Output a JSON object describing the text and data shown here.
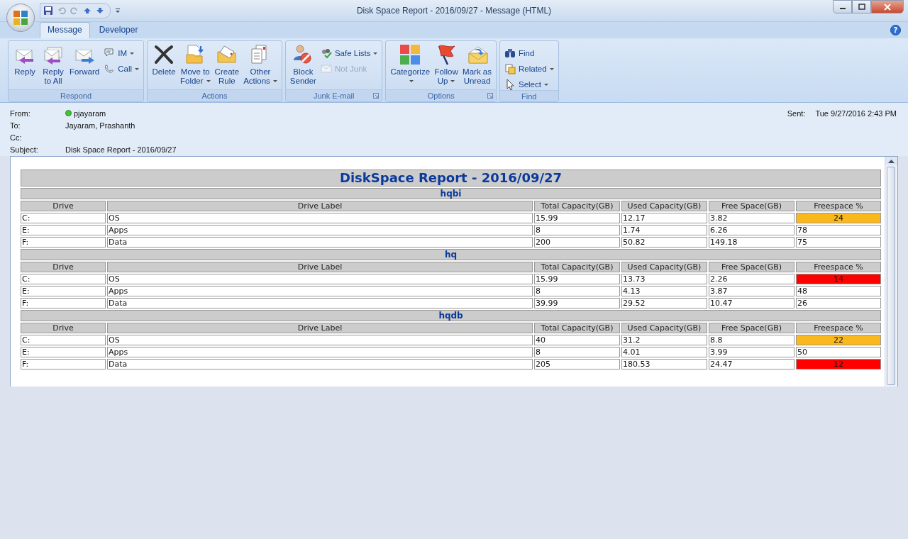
{
  "window": {
    "title": "Disk Space Report - 2016/09/27 - Message (HTML)"
  },
  "help_button": "?",
  "tabs": [
    {
      "label": "Message",
      "selected": true
    },
    {
      "label": "Developer",
      "selected": false
    }
  ],
  "ribbon": {
    "groups": [
      {
        "label": "Respond",
        "launcher": false,
        "items": [
          {
            "kind": "large",
            "lines": [
              "Reply"
            ],
            "dropdown": false,
            "disabled": false
          },
          {
            "kind": "large",
            "lines": [
              "Reply",
              "to All"
            ],
            "dropdown": false,
            "disabled": false
          },
          {
            "kind": "large",
            "lines": [
              "Forward"
            ],
            "dropdown": false,
            "disabled": false
          },
          {
            "kind": "small",
            "lines": [
              "IM"
            ],
            "dropdown": true,
            "disabled": false
          },
          {
            "kind": "small",
            "lines": [
              "Call"
            ],
            "dropdown": true,
            "disabled": false
          }
        ]
      },
      {
        "label": "Actions",
        "launcher": false,
        "items": [
          {
            "kind": "large",
            "lines": [
              "Delete"
            ],
            "dropdown": false,
            "disabled": false
          },
          {
            "kind": "large",
            "lines": [
              "Move to",
              "Folder"
            ],
            "dropdown": true,
            "disabled": false
          },
          {
            "kind": "large",
            "lines": [
              "Create",
              "Rule"
            ],
            "dropdown": false,
            "disabled": false
          },
          {
            "kind": "large",
            "lines": [
              "Other",
              "Actions"
            ],
            "dropdown": true,
            "disabled": false
          }
        ]
      },
      {
        "label": "Junk E-mail",
        "launcher": true,
        "items": [
          {
            "kind": "large",
            "lines": [
              "Block",
              "Sender"
            ],
            "dropdown": false,
            "disabled": false
          },
          {
            "kind": "small",
            "lines": [
              "Safe Lists"
            ],
            "dropdown": true,
            "disabled": false
          },
          {
            "kind": "small",
            "lines": [
              "Not Junk"
            ],
            "dropdown": false,
            "disabled": true
          }
        ]
      },
      {
        "label": "Options",
        "launcher": true,
        "items": [
          {
            "kind": "large",
            "lines": [
              "Categorize"
            ],
            "dropdown": true,
            "disabled": false
          },
          {
            "kind": "large",
            "lines": [
              "Follow",
              "Up"
            ],
            "dropdown": true,
            "disabled": false
          },
          {
            "kind": "large",
            "lines": [
              "Mark as",
              "Unread"
            ],
            "dropdown": false,
            "disabled": false
          }
        ]
      },
      {
        "label": "Find",
        "launcher": false,
        "items": [
          {
            "kind": "small",
            "lines": [
              "Find"
            ],
            "dropdown": false,
            "disabled": false
          },
          {
            "kind": "small",
            "lines": [
              "Related"
            ],
            "dropdown": true,
            "disabled": false
          },
          {
            "kind": "small",
            "lines": [
              "Select"
            ],
            "dropdown": true,
            "disabled": false
          }
        ]
      }
    ]
  },
  "header": {
    "from": {
      "label": "From:",
      "value": "pjayaram"
    },
    "to": {
      "label": "To:",
      "value": "Jayaram, Prashanth"
    },
    "cc": {
      "label": "Cc:"
    },
    "subject": {
      "label": "Subject:",
      "value": "Disk Space Report - 2016/09/27"
    },
    "sent": {
      "label": "Sent:",
      "value": "Tue 9/27/2016 2:43 PM"
    }
  },
  "report": {
    "title": "DiskSpace Report - 2016/09/27",
    "servers": [
      {
        "name": "hqbi",
        "columns": [
          "Drive",
          "Drive Label",
          "Total Capacity(GB)",
          "Used Capacity(GB)",
          "Free Space(GB)",
          "Freespace %"
        ],
        "rows": [
          {
            "cells": [
              "C:",
              "OS",
              "15.99",
              "12.17",
              "3.82",
              "24"
            ],
            "color": "#f9b81c"
          },
          {
            "cells": [
              "E:",
              "Apps",
              "8",
              "1.74",
              "6.26",
              "78"
            ],
            "color": "#ffffff"
          },
          {
            "cells": [
              "F:",
              "Data",
              "200",
              "50.82",
              "149.18",
              "75"
            ],
            "color": "#ffffff"
          }
        ]
      },
      {
        "name": "hq",
        "columns": [
          "Drive",
          "Drive Label",
          "Total Capacity(GB)",
          "Used Capacity(GB)",
          "Free Space(GB)",
          "Freespace %"
        ],
        "rows": [
          {
            "cells": [
              "C:",
              "OS",
              "15.99",
              "13.73",
              "2.26",
              "14"
            ],
            "color": "#ff0000"
          },
          {
            "cells": [
              "E:",
              "Apps",
              "8",
              "4.13",
              "3.87",
              "48"
            ],
            "color": "#ffffff"
          },
          {
            "cells": [
              "F:",
              "Data",
              "39.99",
              "29.52",
              "10.47",
              "26"
            ],
            "color": "#ffffff"
          }
        ]
      },
      {
        "name": "hqdb",
        "columns": [
          "Drive",
          "Drive Label",
          "Total Capacity(GB)",
          "Used Capacity(GB)",
          "Free Space(GB)",
          "Freespace %"
        ],
        "rows": [
          {
            "cells": [
              "C:",
              "OS",
              "40",
              "31.2",
              "8.8",
              "22"
            ],
            "color": "#f9b81c"
          },
          {
            "cells": [
              "E:",
              "Apps",
              "8",
              "4.01",
              "3.99",
              "50"
            ],
            "color": "#ffffff"
          },
          {
            "cells": [
              "F:",
              "Data",
              "205",
              "180.53",
              "24.47",
              "12"
            ],
            "color": "#ff0000"
          }
        ]
      }
    ]
  }
}
